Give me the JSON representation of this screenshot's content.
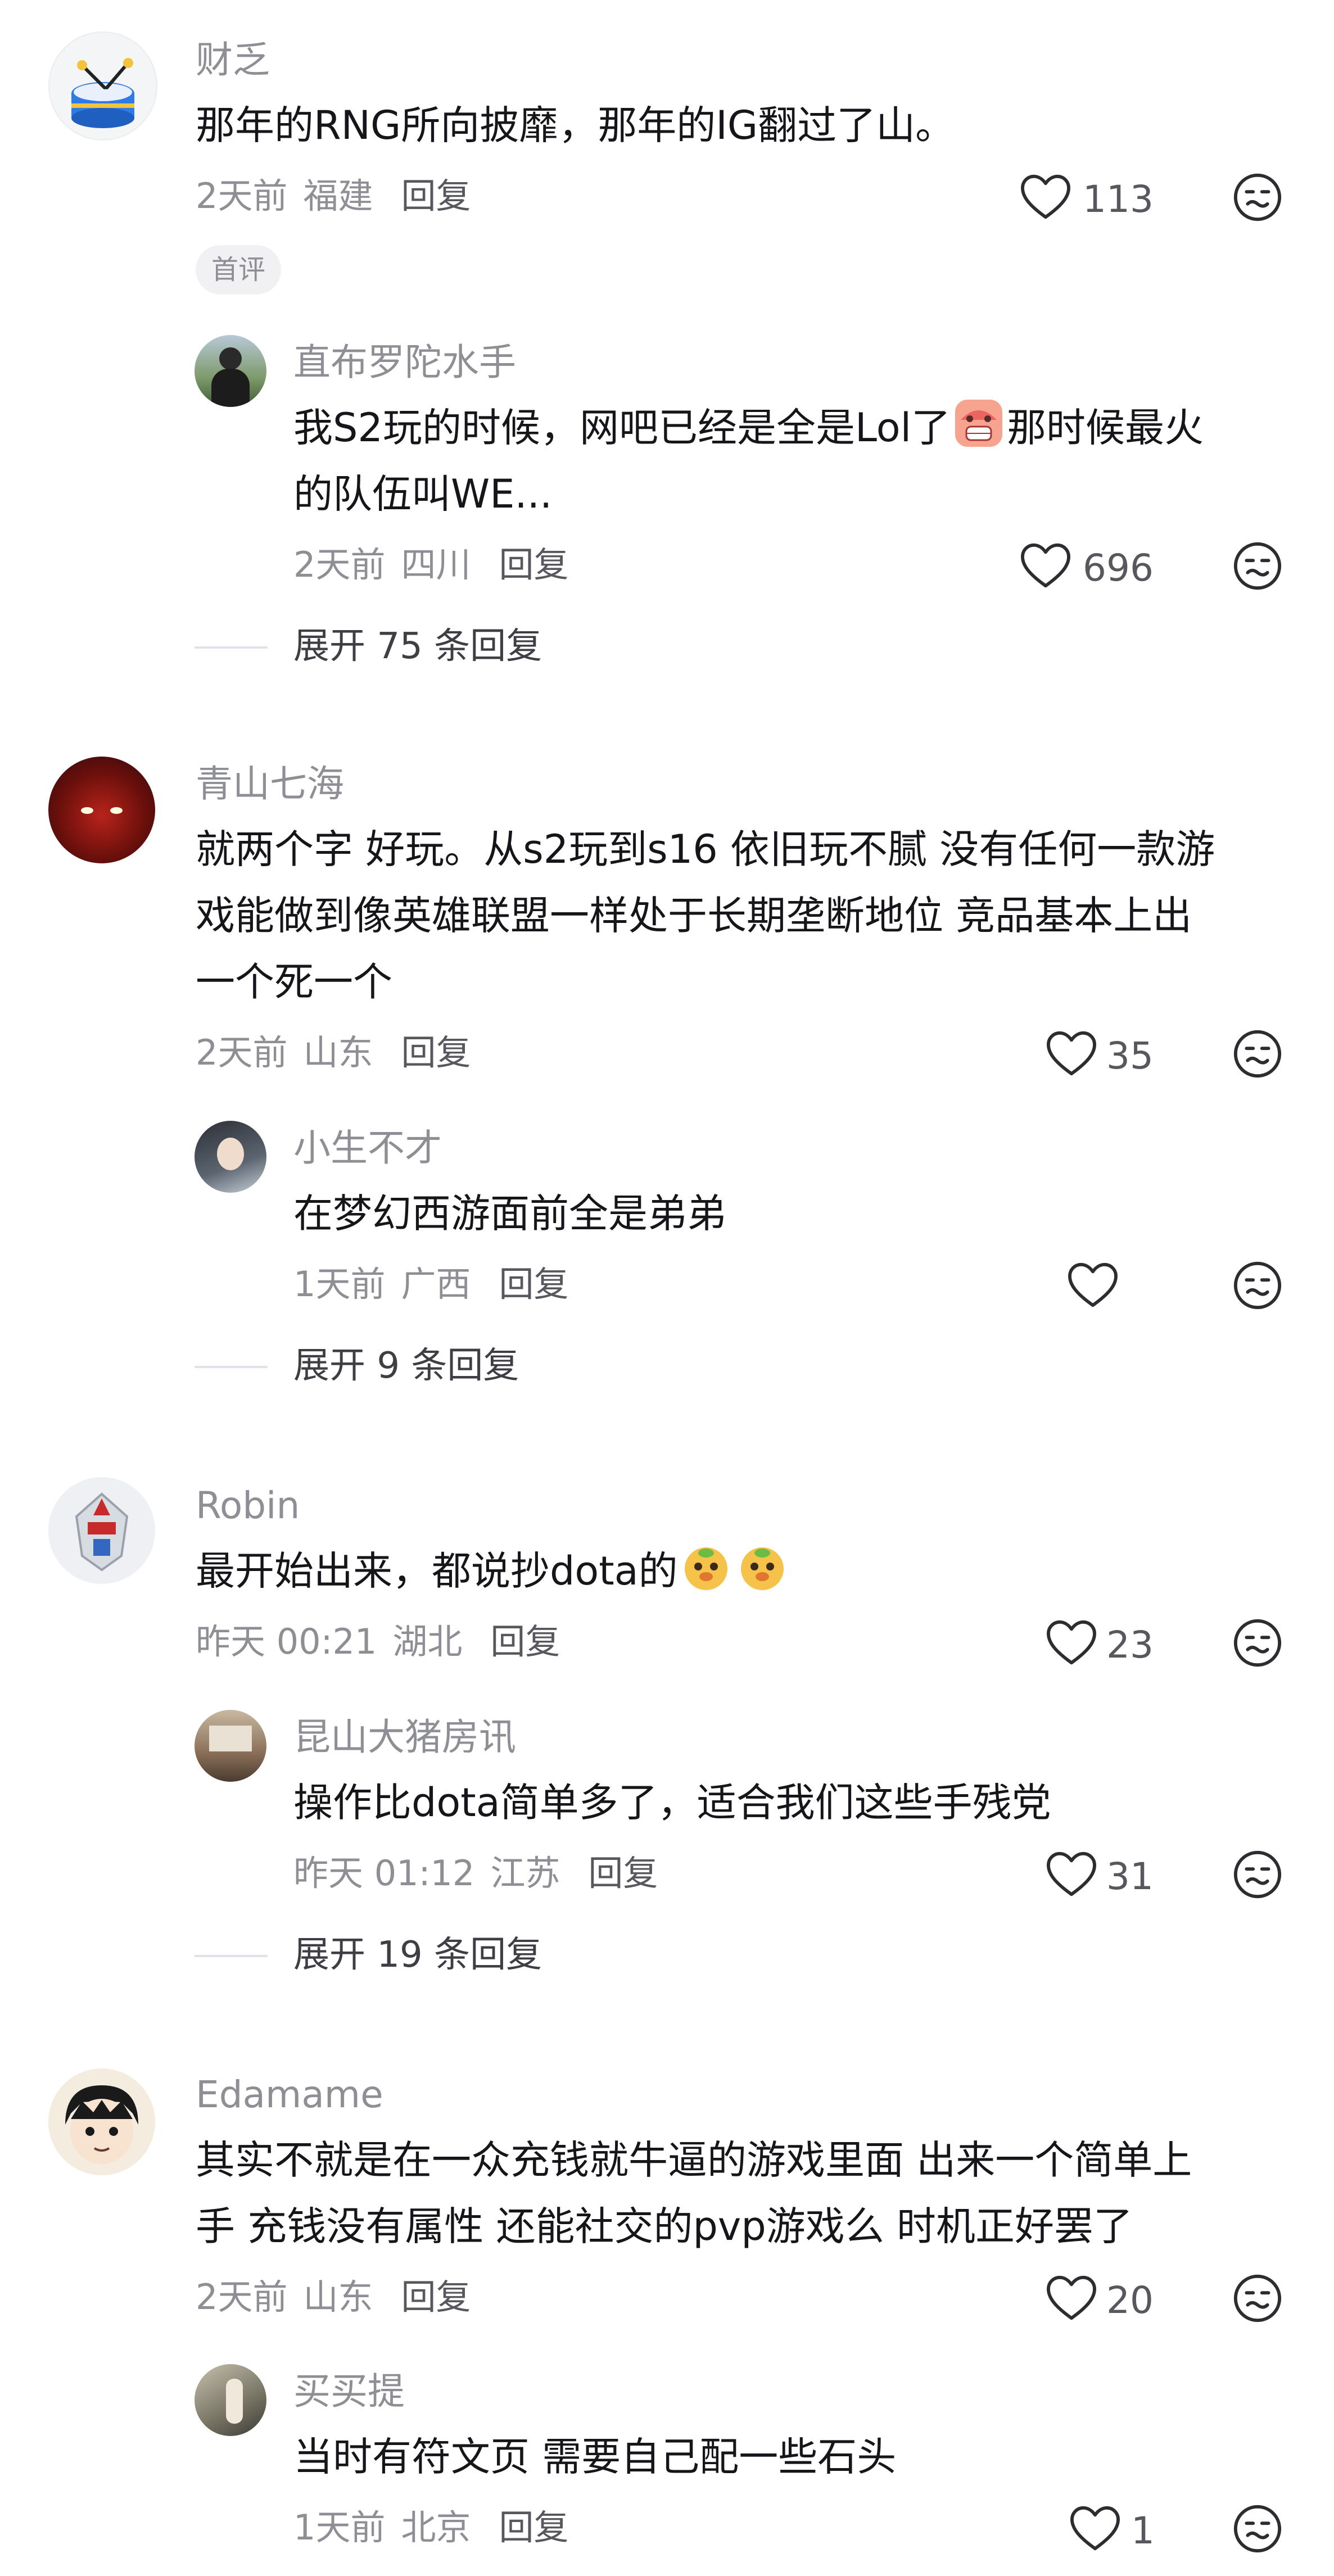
{
  "comments": [
    {
      "author": "财乏",
      "content_lines": [
        "那年的RNG所向披靡，那年的IG翻过了山。"
      ],
      "time": "2天前",
      "location": "福建",
      "reply_label": "回复",
      "likes": "113",
      "badge": "首评",
      "reply": {
        "author": "直布罗陀水手",
        "content_line1": "我S2玩的时候，网吧已经是全是Lol了",
        "content_line1b": "那时候最火",
        "content_line2": "的队伍叫WE...",
        "time": "2天前",
        "location": "四川",
        "reply_label": "回复",
        "likes": "696"
      },
      "expand": "展开 75 条回复"
    },
    {
      "author": "青山七海",
      "content_lines": [
        "就两个字 好玩。从s2玩到s16 依旧玩不腻 没有任何一款游",
        "戏能做到像英雄联盟一样处于长期垄断地位 竞品基本上出",
        "一个死一个"
      ],
      "time": "2天前",
      "location": "山东",
      "reply_label": "回复",
      "likes": "35",
      "reply": {
        "author": "小生不才",
        "content": "在梦幻西游面前全是弟弟",
        "time": "1天前",
        "location": "广西",
        "reply_label": "回复",
        "likes": ""
      },
      "expand": "展开 9 条回复"
    },
    {
      "author": "Robin",
      "content": "最开始出来，都说抄dota的",
      "time": "昨天 00:21",
      "location": "湖北",
      "reply_label": "回复",
      "likes": "23",
      "reply": {
        "author": "昆山大猪房讯",
        "content": "操作比dota简单多了，适合我们这些手残党",
        "time": "昨天 01:12",
        "location": "江苏",
        "reply_label": "回复",
        "likes": "31"
      },
      "expand": "展开 19 条回复"
    },
    {
      "author": "Edamame",
      "content_lines": [
        "其实不就是在一众充钱就牛逼的游戏里面 出来一个简单上",
        "手 充钱没有属性  还能社交的pvp游戏么   时机正好罢了"
      ],
      "time": "2天前",
      "location": "山东",
      "reply_label": "回复",
      "likes": "20",
      "reply": {
        "author": "买买提",
        "content": "当时有符文页 需要自己配一些石头",
        "time": "1天前",
        "location": "北京",
        "reply_label": "回复",
        "likes": "1"
      }
    }
  ],
  "colors": {
    "muted": "#8e8e95",
    "text": "#16161a",
    "divider": "#e2e2e6"
  },
  "icons": [
    "heart-icon",
    "dislike-face-icon",
    "drum-icon",
    "grimace-emoji-icon",
    "doge-emoji-icon"
  ]
}
